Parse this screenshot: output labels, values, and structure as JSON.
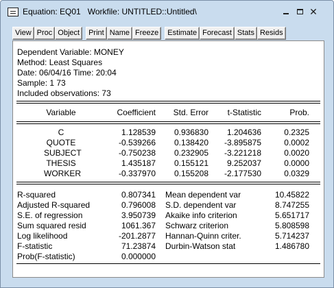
{
  "window": {
    "title": "Equation: EQ01   Workfile: UNTITLED::Untitled\\",
    "icons": [
      "equation-window-icon",
      "minimize-icon",
      "maximize-icon",
      "close-icon"
    ]
  },
  "toolbar": {
    "buttons": [
      "View",
      "Proc",
      "Object",
      "Print",
      "Name",
      "Freeze",
      "Estimate",
      "Forecast",
      "Stats",
      "Resids"
    ]
  },
  "header": {
    "dependent": "Dependent Variable: MONEY",
    "method": "Method: Least Squares",
    "date": "Date: 06/04/16   Time: 20:04",
    "sample": "Sample: 1 73",
    "observations": "Included observations: 73"
  },
  "table": {
    "columns": [
      "Variable",
      "Coefficient",
      "Std. Error",
      "t-Statistic",
      "Prob."
    ],
    "rows": [
      [
        "C",
        "1.128539",
        "0.936830",
        "1.204636",
        "0.2325"
      ],
      [
        "QUOTE",
        "-0.539266",
        "0.138420",
        "-3.895875",
        "0.0002"
      ],
      [
        "SUBJECT",
        "-0.750238",
        "0.232905",
        "-3.221218",
        "0.0020"
      ],
      [
        "THESIS",
        "1.435187",
        "0.155121",
        "9.252037",
        "0.0000"
      ],
      [
        "WORKER",
        "-0.337970",
        "0.155208",
        "-2.177530",
        "0.0329"
      ]
    ]
  },
  "stats": {
    "left": [
      [
        "R-squared",
        "0.807341"
      ],
      [
        "Adjusted R-squared",
        "0.796008"
      ],
      [
        "S.E. of regression",
        "3.950739"
      ],
      [
        "Sum squared resid",
        "1061.367"
      ],
      [
        "Log likelihood",
        "-201.2877"
      ],
      [
        "F-statistic",
        "71.23874"
      ],
      [
        "Prob(F-statistic)",
        "0.000000"
      ]
    ],
    "right": [
      [
        "Mean dependent var",
        "10.45822"
      ],
      [
        "S.D. dependent var",
        "8.747255"
      ],
      [
        "Akaike info criterion",
        "5.651717"
      ],
      [
        "Schwarz criterion",
        "5.808598"
      ],
      [
        "Hannan-Quinn criter.",
        "5.714237"
      ],
      [
        "Durbin-Watson stat",
        "1.486780"
      ]
    ]
  }
}
